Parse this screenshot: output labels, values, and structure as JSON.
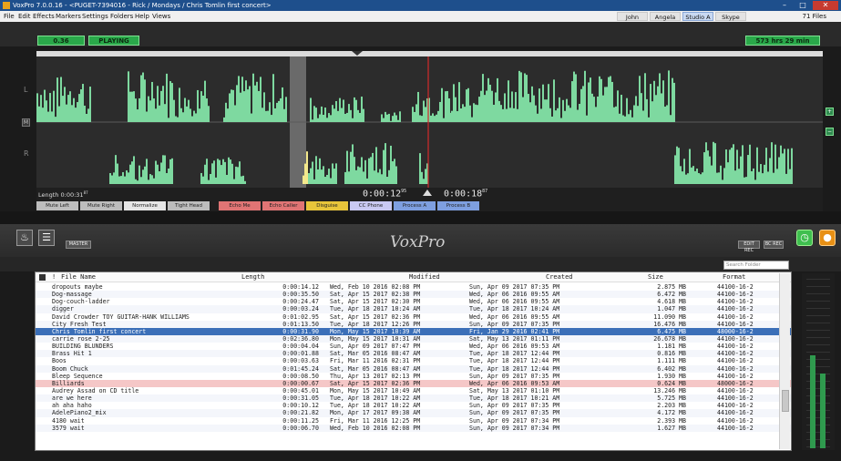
{
  "window": {
    "title": "VoxPro 7.0.0.16 - <PUGET-7394016 - Rick / Mondays / Chris Tomlin first concert>",
    "min_label": "–",
    "max_label": "□",
    "close_label": "✕"
  },
  "menu": {
    "items": [
      "File",
      "Edit",
      "Effects",
      "Markers",
      "Settings",
      "Folders",
      "Help",
      "Views"
    ],
    "users": [
      "John",
      "Angela",
      "Studio A",
      "Skype"
    ],
    "active_user": "Studio A",
    "files_count": "71 Files"
  },
  "status": {
    "position": "0.36",
    "state": "PLAYING",
    "total_time": "573 hrs 29 min"
  },
  "waveform": {
    "left_label": "L",
    "right_label": "R",
    "m_label": "M"
  },
  "timebar": {
    "length_label": "Length",
    "length_value": "0:00:31",
    "length_frac": "87",
    "time_a": "0:00:12",
    "time_a_frac": "95",
    "time_b": "0:00:18",
    "time_b_frac": "87"
  },
  "effects": [
    {
      "label": "Mute Left",
      "color": "#bdbdbd"
    },
    {
      "label": "Mute Right",
      "color": "#bdbdbd"
    },
    {
      "label": "Normalize",
      "color": "#e6e6e6"
    },
    {
      "label": "Tight Head",
      "color": "#bdbdbd"
    },
    {
      "label": "Echo Me",
      "color": "#e07474"
    },
    {
      "label": "Echo Caller",
      "color": "#e07474"
    },
    {
      "label": "Disguise",
      "color": "#e8c53a"
    },
    {
      "label": "CC Phone",
      "color": "#c9c9f2"
    },
    {
      "label": "Process A",
      "color": "#7e9fe0"
    },
    {
      "label": "Process B",
      "color": "#7e9fe0"
    }
  ],
  "toolbar": {
    "master_label": "MASTER",
    "edit_rec_label": "EDIT REC",
    "bc_rec_label": "BC REC",
    "logo": "VoxPro"
  },
  "search": {
    "placeholder": "Search Folder"
  },
  "list": {
    "headers": {
      "flag": "!",
      "name": "File Name",
      "length": "Length",
      "modified": "Modified",
      "created": "Created",
      "size": "Size",
      "format": "Format"
    },
    "rows": [
      {
        "name": "dropouts maybe",
        "length": "0:00:14.12",
        "modified": "Wed, Feb 10 2016  02:08 PM",
        "created": "Sun, Apr 09 2017  07:35 PM",
        "size": "2.875 MB",
        "format": "44100-16-2"
      },
      {
        "name": "Dog-massage",
        "length": "0:00:35.50",
        "modified": "Sat, Apr 15 2017  02:38 PM",
        "created": "Wed, Apr 06 2016  09:55 AM",
        "size": "6.472 MB",
        "format": "44100-16-2"
      },
      {
        "name": "Dog-couch-ladder",
        "length": "0:00:24.47",
        "modified": "Sat, Apr 15 2017  02:30 PM",
        "created": "Wed, Apr 06 2016  09:55 AM",
        "size": "4.618 MB",
        "format": "44100-16-2"
      },
      {
        "name": "digger",
        "length": "0:00:03.24",
        "modified": "Tue, Apr 18 2017  10:24 AM",
        "created": "Tue, Apr 18 2017  10:24 AM",
        "size": "1.047 MB",
        "format": "44100-16-2"
      },
      {
        "name": "David Crowder TOY GUITAR-HANK WILLIAMS",
        "length": "0:01:02.95",
        "modified": "Sat, Apr 15 2017  02:36 PM",
        "created": "Wed, Apr 06 2016  09:55 AM",
        "size": "11.090 MB",
        "format": "44100-16-2"
      },
      {
        "name": "City Fresh Test",
        "length": "0:01:13.50",
        "modified": "Tue, Apr 18 2017  12:26 PM",
        "created": "Sun, Apr 09 2017  07:35 PM",
        "size": "16.476 MB",
        "format": "44100-16-2"
      },
      {
        "name": "Chris Tomlin first concert",
        "length": "0:00:31.90",
        "modified": "Mon, May 15 2017  10:39 AM",
        "created": "Fri, Jan 29 2016  02:41 PM",
        "size": "6.475 MB",
        "format": "48000-16-2",
        "state": "sel"
      },
      {
        "name": "carrie rose 2-25",
        "length": "0:02:36.80",
        "modified": "Mon, May 15 2017  10:31 AM",
        "created": "Sat, May 13 2017  01:11 PM",
        "size": "26.678 MB",
        "format": "44100-16-2"
      },
      {
        "name": "BUILDING BLUNDERS",
        "length": "0:00:04.04",
        "modified": "Sun, Apr 09 2017  07:47 PM",
        "created": "Wed, Apr 06 2016  09:53 AM",
        "size": "1.181 MB",
        "format": "44100-16-2"
      },
      {
        "name": "Brass Hit 1",
        "length": "0:00:01.88",
        "modified": "Sat, Mar 05 2016  08:47 AM",
        "created": "Tue, Apr 18 2017  12:44 PM",
        "size": "0.816 MB",
        "format": "44100-16-2"
      },
      {
        "name": "Boos",
        "length": "0:00:03.63",
        "modified": "Fri, Mar 11 2016  02:31 PM",
        "created": "Tue, Apr 18 2017  12:44 PM",
        "size": "1.111 MB",
        "format": "44100-16-2"
      },
      {
        "name": "Boom Chuck",
        "length": "0:01:45.24",
        "modified": "Sat, Mar 05 2016  08:47 AM",
        "created": "Tue, Apr 18 2017  12:44 PM",
        "size": "6.402 MB",
        "format": "44100-16-2"
      },
      {
        "name": "Bleep Sequence",
        "length": "0:00:08.50",
        "modified": "Thu, Apr 13 2017  02:13 PM",
        "created": "Sun, Apr 09 2017  07:35 PM",
        "size": "1.930 MB",
        "format": "44100-16-2"
      },
      {
        "name": "Billiards",
        "length": "0:00:00.67",
        "modified": "Sat, Apr 15 2017  02:36 PM",
        "created": "Wed, Apr 06 2016  09:53 AM",
        "size": "0.624 MB",
        "format": "48000-16-2",
        "state": "hl"
      },
      {
        "name": "Audrey Assad on CD title",
        "length": "0:00:45.01",
        "modified": "Mon, May 15 2017  10:49 AM",
        "created": "Sat, May 13 2017  01:10 PM",
        "size": "13.246 MB",
        "format": "44100-16-2"
      },
      {
        "name": "are we here",
        "length": "0:00:31.05",
        "modified": "Tue, Apr 18 2017  10:22 AM",
        "created": "Tue, Apr 18 2017  10:21 AM",
        "size": "5.725 MB",
        "format": "44100-16-2"
      },
      {
        "name": "ah aha haho",
        "length": "0:00:10.12",
        "modified": "Tue, Apr 18 2017  10:22 AM",
        "created": "Sun, Apr 09 2017  07:35 PM",
        "size": "2.203 MB",
        "format": "44100-16-2"
      },
      {
        "name": "AdelePiano2_mix",
        "length": "0:00:21.82",
        "modified": "Mon, Apr 17 2017  09:38 AM",
        "created": "Sun, Apr 09 2017  07:35 PM",
        "size": "4.172 MB",
        "format": "44100-16-2"
      },
      {
        "name": "4180 wait",
        "length": "0:00:11.25",
        "modified": "Fri, Mar 11 2016  12:25 PM",
        "created": "Sun, Apr 09 2017  07:34 PM",
        "size": "2.393 MB",
        "format": "44100-16-2"
      },
      {
        "name": "3579 wait",
        "length": "0:00:06.70",
        "modified": "Wed, Feb 10 2016  02:08 PM",
        "created": "Sun, Apr 09 2017  07:34 PM",
        "size": "1.627 MB",
        "format": "44100-16-2"
      }
    ]
  },
  "colors": {
    "wave": "#7ed9a0",
    "wave_selected": "#f3e88c",
    "selection": "#6a6a6a",
    "playhead": "#d32b2b",
    "accent": "#2aa84a"
  }
}
